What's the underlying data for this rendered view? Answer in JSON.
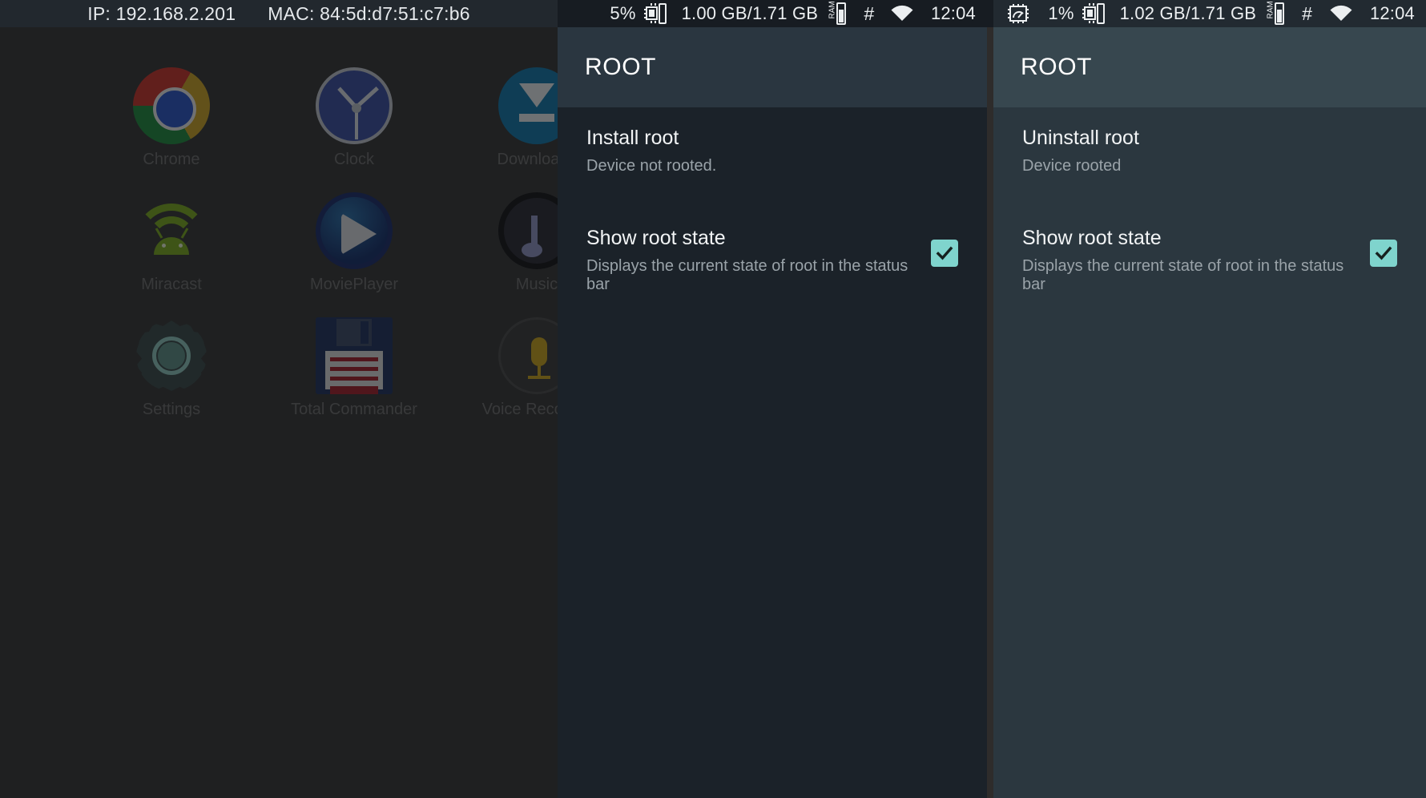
{
  "launcher": {
    "status_bar": {
      "ip_label": "IP: 192.168.2.201",
      "mac_label": "MAC: 84:5d:d7:51:c7:b6"
    },
    "apps": [
      {
        "label": "Chrome",
        "icon": "chrome-icon"
      },
      {
        "label": "Clock",
        "icon": "clock-icon"
      },
      {
        "label": "Downloads",
        "icon": "downloads-icon"
      },
      {
        "label": "Miracast",
        "icon": "miracast-icon"
      },
      {
        "label": "MoviePlayer",
        "icon": "movieplayer-icon"
      },
      {
        "label": "Music",
        "icon": "music-icon"
      },
      {
        "label": "Settings",
        "icon": "settings-icon"
      },
      {
        "label": "Total Commander",
        "icon": "floppy-disk-icon"
      },
      {
        "label": "Voice Recorder",
        "icon": "voice-recorder-icon"
      }
    ]
  },
  "middle_panel": {
    "status_bar": {
      "cpu_percent": "5%",
      "cpu_icon": "cpu-chip-icon",
      "ram_usage": "1.00 GB/1.71 GB",
      "ram_icon": "ram-meter-icon",
      "root_icon": "root-hash-icon",
      "wifi_icon": "wifi-icon",
      "clock": "12:04"
    },
    "header": {
      "title": "ROOT"
    },
    "preferences": [
      {
        "name": "install-root",
        "title": "Install root",
        "summary": "Device not rooted.",
        "has_checkbox": false,
        "checked": false
      },
      {
        "name": "show-root-state",
        "title": "Show root state",
        "summary": "Displays the current state of root in the status bar",
        "has_checkbox": true,
        "checked": true
      }
    ]
  },
  "right_panel": {
    "status_bar": {
      "gauge_icon": "cpu-gauge-icon",
      "cpu_percent": "1%",
      "cpu_icon": "cpu-chip-icon",
      "ram_usage": "1.02 GB/1.71 GB",
      "ram_icon": "ram-meter-icon",
      "root_icon": "root-hash-icon",
      "wifi_icon": "wifi-icon",
      "clock": "12:04"
    },
    "header": {
      "title": "ROOT"
    },
    "preferences": [
      {
        "name": "uninstall-root",
        "title": "Uninstall root",
        "summary": "Device rooted",
        "has_checkbox": false,
        "checked": false
      },
      {
        "name": "show-root-state",
        "title": "Show root state",
        "summary": "Displays the current state of root in the status bar",
        "has_checkbox": true,
        "checked": true
      }
    ]
  },
  "colors": {
    "checkbox_accent": "#7fd4cd",
    "header_mid": "#2a3640",
    "header_right": "#37474f",
    "body_mid": "#1b2229",
    "body_right": "#2b373f",
    "statusbar": "#1b2127",
    "launcher_bg": "#363636"
  }
}
